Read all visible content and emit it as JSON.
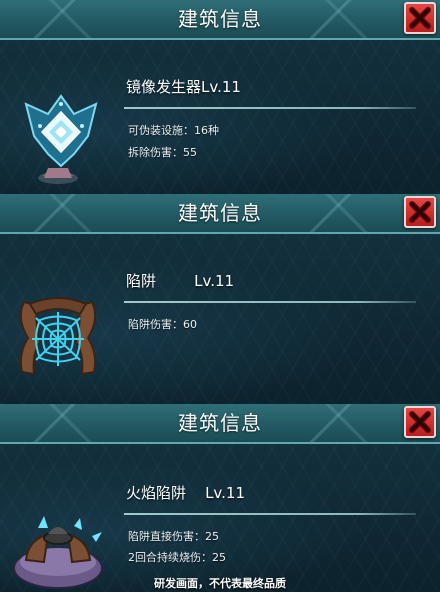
{
  "panels": [
    {
      "title": "建筑信息",
      "name": "镜像发生器Lv.11",
      "stats": [
        "可伪装设施：16种",
        "拆除伤害：55"
      ],
      "icon": "mirror-generator-icon"
    },
    {
      "title": "建筑信息",
      "name": "陷阱        Lv.11",
      "stats": [
        "陷阱伤害：60"
      ],
      "icon": "web-trap-icon"
    },
    {
      "title": "建筑信息",
      "name": "火焰陷阱    Lv.11",
      "stats": [
        "陷阱直接伤害：25",
        "2回合持续烧伤：25"
      ],
      "icon": "fire-trap-icon"
    }
  ],
  "footer": {
    "note": "研发画面，不代表最终品质"
  },
  "colors": {
    "header": "#235a63",
    "close": "#d22b2b",
    "background": "#0d2530"
  }
}
